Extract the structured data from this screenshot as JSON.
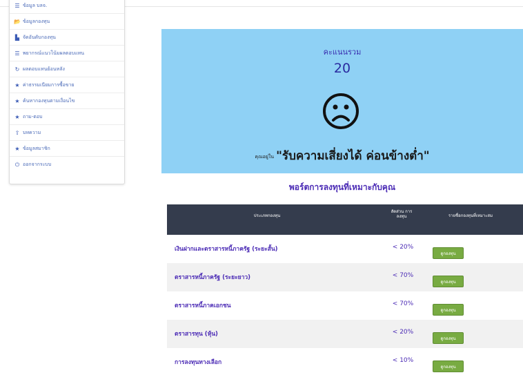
{
  "sidebar": {
    "items": [
      {
        "icon": "list-icon",
        "glyph": "☰",
        "label": "ข้อมูล บลจ."
      },
      {
        "icon": "folder-open-icon",
        "glyph": "📂",
        "label": "ข้อมูลกองทุน"
      },
      {
        "icon": "file-icon",
        "glyph": "▙",
        "label": "จัดอันดับกองทุน"
      },
      {
        "icon": "list-icon",
        "glyph": "☰",
        "label": "พยากรณ์แนวโน้มผลตอบแทน"
      },
      {
        "icon": "refresh-icon",
        "glyph": "↻",
        "label": "ผลตอบแทนย้อนหลัง"
      },
      {
        "icon": "star-icon",
        "glyph": "★",
        "label": "ค่าธรรมเนียมการซื้อขาย"
      },
      {
        "icon": "star-icon",
        "glyph": "★",
        "label": "ค้นหากองทุนตามเงื่อนไข"
      },
      {
        "icon": "star-icon",
        "glyph": "★",
        "label": "ถาม-ตอบ"
      },
      {
        "icon": "upload-icon",
        "glyph": "⇧",
        "label": "บทความ"
      },
      {
        "icon": "star-icon",
        "glyph": "★",
        "label": "ข้อมูลสมาชิก"
      },
      {
        "icon": "power-icon",
        "glyph": "⏻",
        "label": "ออกจากระบบ"
      }
    ]
  },
  "score": {
    "label": "คะแนนรวม",
    "value": "20",
    "risk_prefix": "คุณอยู่ใน",
    "risk_level": "\"รับความเสี่ยงได้ ค่อนข้างต่ำ\""
  },
  "portfolio": {
    "title": "พอร์ตการลงทุนที่เหมาะกับคุณ",
    "headers": {
      "type": "ประเภทกองทุน",
      "ratio": "สัดส่วน การ ลงทุน",
      "funds": "รายชื่อกองทุนที่เหมาะสม"
    },
    "button_label": "ดูกองทุน",
    "rows": [
      {
        "type": "เงินฝากและตราสารหนี้ภาครัฐ (ระยะสั้น)",
        "ratio": "< 20%"
      },
      {
        "type": "ตราสารหนี้ภาครัฐ (ระยะยาว)",
        "ratio": "< 70%"
      },
      {
        "type": "ตราสารหนี้ภาคเอกชน",
        "ratio": "< 70%"
      },
      {
        "type": "ตราสารทุน (หุ้น)",
        "ratio": "< 20%"
      },
      {
        "type": "การลงทุนทางเลือก",
        "ratio": "< 10%"
      }
    ]
  },
  "colors": {
    "panel_bg": "#8fd1f5",
    "accent_text": "#4b2bb5",
    "table_header": "#343c4d",
    "button": "#78ab42"
  }
}
